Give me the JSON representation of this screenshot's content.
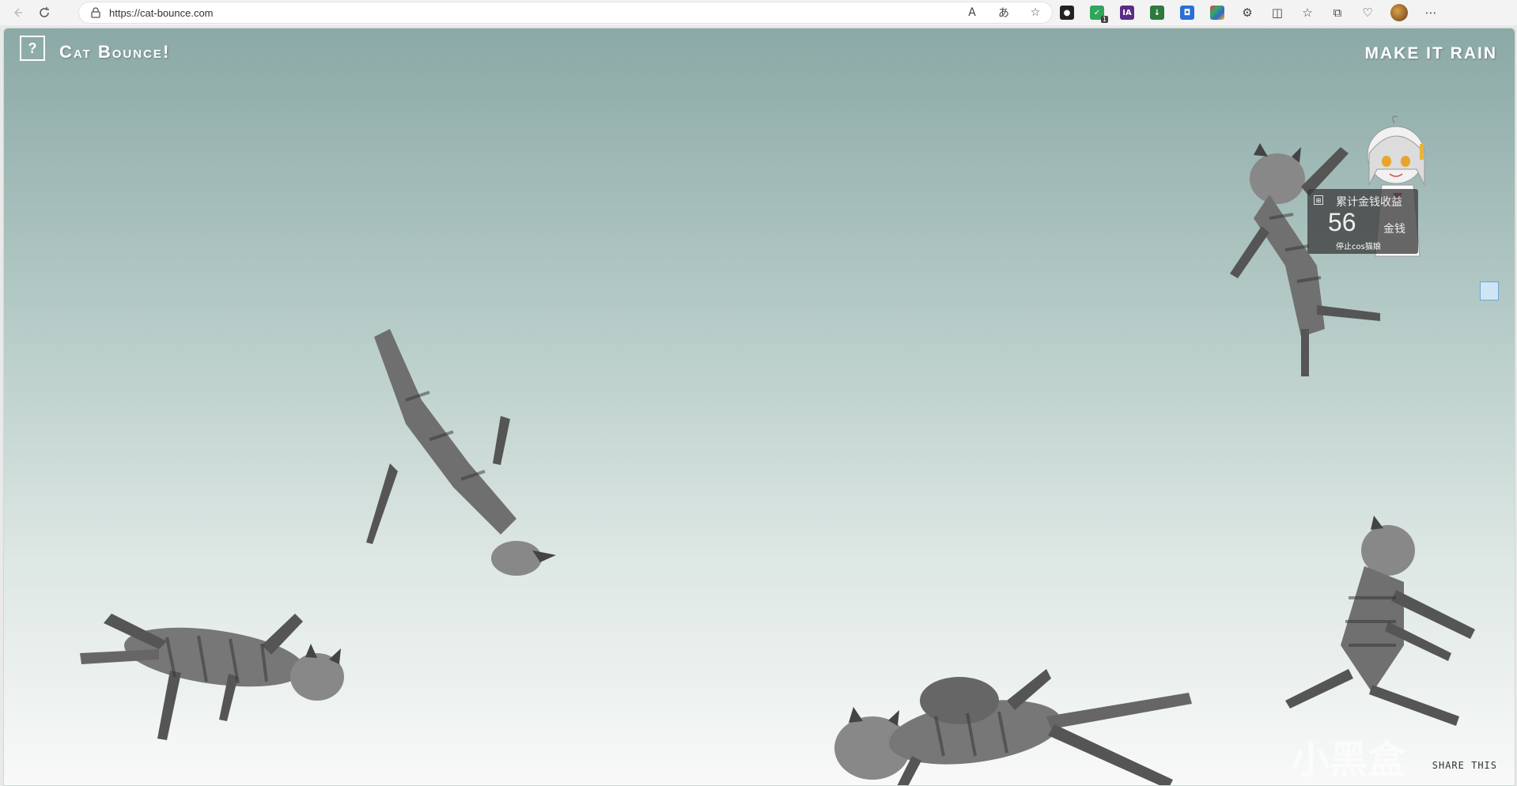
{
  "browser": {
    "url": "https://cat-bounce.com",
    "ext_badge": "1",
    "ia_label": "IA"
  },
  "page": {
    "help_label": "?",
    "title": "Cat Bounce!",
    "make_it_rain": "MAKE IT RAIN",
    "share": "SHARE THIS"
  },
  "widget": {
    "title": "累计金钱收益",
    "value": "56",
    "unit": "金钱",
    "stop": "停止cos猫娘"
  },
  "watermark": "小黑盒"
}
